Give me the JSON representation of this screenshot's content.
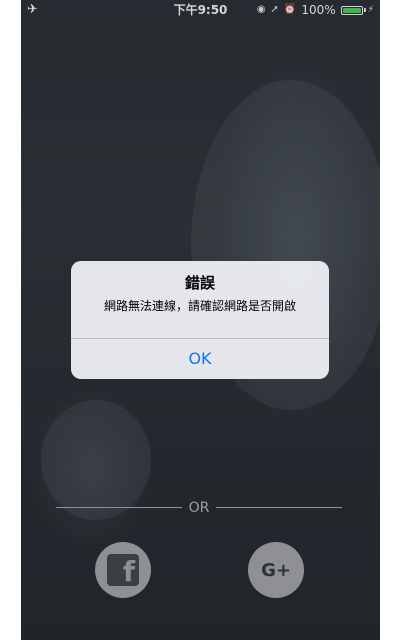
{
  "status_bar": {
    "airplane_icon": "airplane-icon",
    "time": "下午9:50",
    "battery": "100%"
  },
  "alert": {
    "title": "錯誤",
    "message": "網路無法連線，請確認網路是否開啟",
    "ok_label": "OK"
  },
  "divider": {
    "or_label": "OR"
  },
  "social": {
    "facebook_glyph": "f",
    "google_plus_glyph": "G+"
  },
  "colors": {
    "accent": "#1a73e8",
    "battery": "#4cd964"
  }
}
